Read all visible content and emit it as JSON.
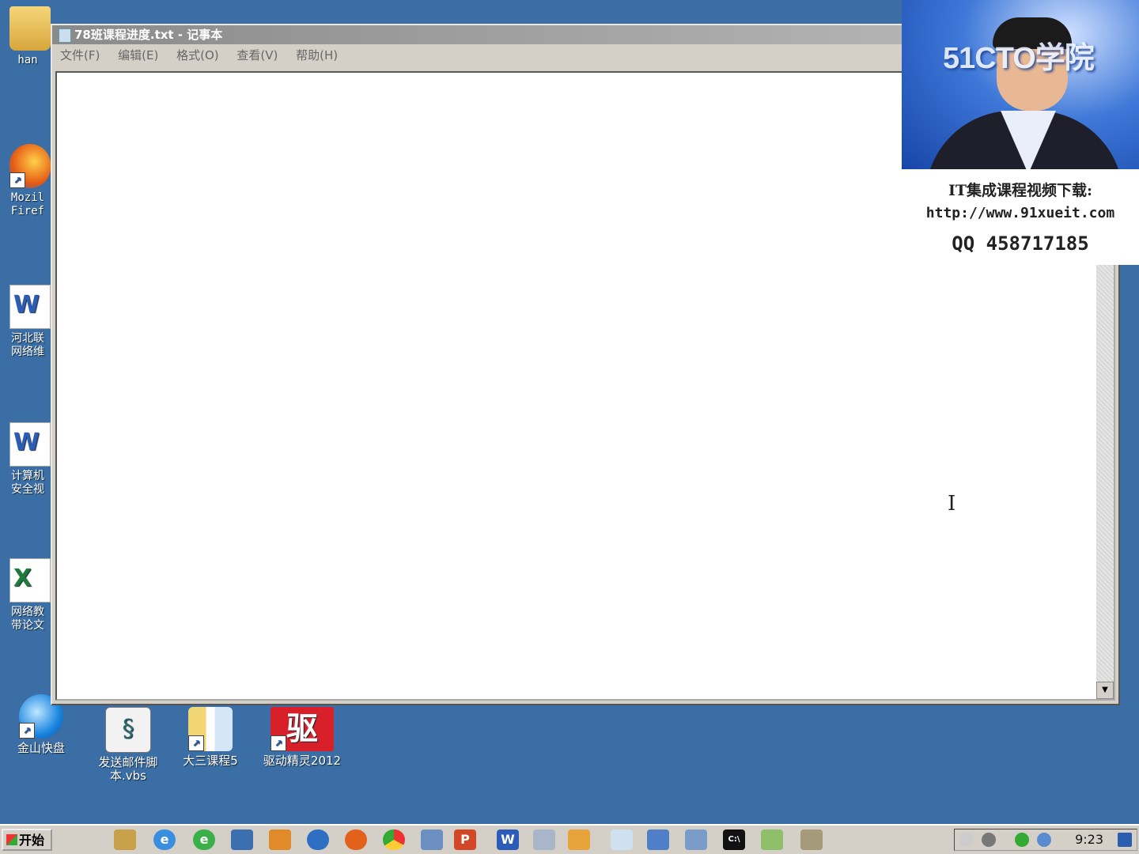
{
  "desktop": {
    "left_icons": [
      {
        "label": "han",
        "icon": "user-folder-icon"
      },
      {
        "label": "Mozil\nFiref",
        "icon": "firefox-icon"
      },
      {
        "label": "河北联\n网络维",
        "icon": "word-doc-icon"
      },
      {
        "label": "计算机\n安全视",
        "icon": "word-doc-icon"
      },
      {
        "label": "网络教\n带论文",
        "icon": "excel-doc-icon"
      }
    ],
    "bottom_icons": [
      {
        "label": "金山快盘",
        "icon": "kuaipan-icon"
      },
      {
        "label": "发送邮件脚\n本.vbs",
        "icon": "script-file-icon"
      },
      {
        "label": "大三课程5",
        "icon": "folder-icon"
      },
      {
        "label": "驱动精灵2012",
        "icon": "drive-genius-icon"
      }
    ],
    "bottom_icon_glyphs": {
      "drive_genius": "驱"
    }
  },
  "notepad": {
    "title": "78班课程进度.txt - 记事本",
    "menu": [
      "文件(F)",
      "编辑(E)",
      "格式(O)",
      "查看(V)",
      "帮助(H)"
    ],
    "content": ""
  },
  "overlay": {
    "brand": "51CTO学院",
    "line1": "IT集成课程视频下载:",
    "line2": "http://www.91xueit.com",
    "line3": "QQ 458717185"
  },
  "taskbar": {
    "start_label": "开始",
    "clock": "9:23",
    "quicklaunch": [
      "explorer-icon",
      "ie-icon",
      "ie-green-icon",
      "media-icon",
      "tool-icon",
      "globe-icon",
      "firefox-icon",
      "chrome-icon",
      "calc-icon",
      "powerpoint-icon",
      "word-icon",
      "paint-icon",
      "app-icon",
      "notepad-icon",
      "network-icon",
      "vmware-icon",
      "cmd-icon",
      "notepad2-icon",
      "shield-icon"
    ],
    "cmd_label": "C:\\"
  }
}
